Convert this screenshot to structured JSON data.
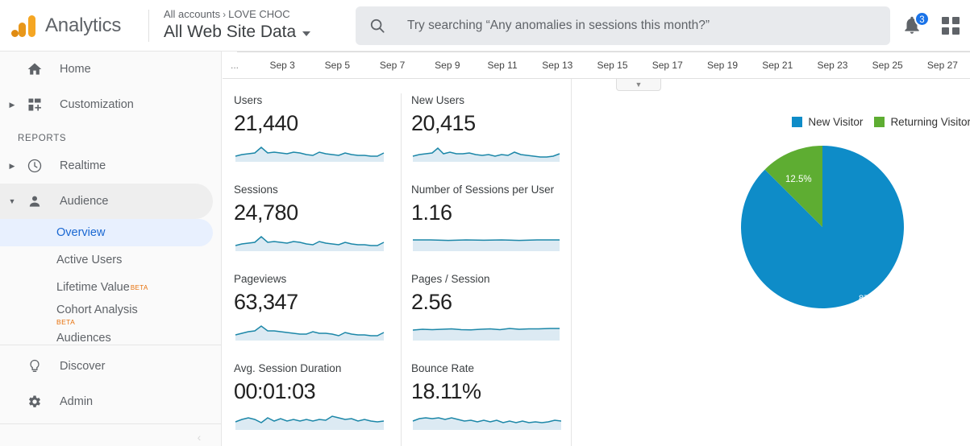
{
  "app": {
    "brand_name": "Analytics",
    "logo_icon": "analytics-logo-icon"
  },
  "header": {
    "breadcrumb_root": "All accounts",
    "breadcrumb_separator": "›",
    "breadcrumb_account": "LOVE CHOC",
    "property_title": "All Web Site Data",
    "property_caret_icon": "chevron-down-icon",
    "search": {
      "icon": "search-icon",
      "placeholder": "Try searching “Any anomalies in sessions this month?”",
      "value": ""
    },
    "notifications": {
      "icon": "bell-icon",
      "count": "3"
    },
    "apps_icon": "grid-apps-icon"
  },
  "sidebar": {
    "top_items": [
      {
        "label": "Home",
        "icon": "home-icon",
        "expandable": false,
        "selected": false
      },
      {
        "label": "Customization",
        "icon": "customization-icon",
        "expandable": true,
        "selected": false
      }
    ],
    "section_label": "REPORTS",
    "report_items": [
      {
        "label": "Realtime",
        "icon": "clock-icon",
        "expandable": true,
        "selected": false
      },
      {
        "label": "Audience",
        "icon": "person-icon",
        "expandable": true,
        "selected": true
      }
    ],
    "audience_subitems": [
      {
        "label": "Overview",
        "active": true,
        "beta": ""
      },
      {
        "label": "Active Users",
        "active": false,
        "beta": ""
      },
      {
        "label": "Lifetime Value",
        "active": false,
        "beta": "BETA"
      },
      {
        "label": "Cohort Analysis",
        "active": false,
        "beta": "BETA"
      }
    ],
    "clipped_item": "Audiences",
    "bottom_items": [
      {
        "label": "Discover",
        "icon": "lightbulb-icon"
      },
      {
        "label": "Admin",
        "icon": "gear-icon"
      }
    ],
    "collapse_icon": "collapse-arrow-icon"
  },
  "main": {
    "date_axis": {
      "leading_ellipsis": "...",
      "ticks": [
        "Sep 3",
        "Sep 5",
        "Sep 7",
        "Sep 9",
        "Sep 11",
        "Sep 13",
        "Sep 15",
        "Sep 17",
        "Sep 19",
        "Sep 21",
        "Sep 23",
        "Sep 25",
        "Sep 27"
      ],
      "toggle_icon": "chevron-down-icon"
    },
    "metrics": [
      {
        "title": "Users",
        "value": "21,440"
      },
      {
        "title": "New Users",
        "value": "20,415"
      },
      {
        "title": "Sessions",
        "value": "24,780"
      },
      {
        "title": "Number of Sessions per User",
        "value": "1.16"
      },
      {
        "title": "Pageviews",
        "value": "63,347"
      },
      {
        "title": "Pages / Session",
        "value": "2.56"
      },
      {
        "title": "Avg. Session Duration",
        "value": "00:01:03"
      },
      {
        "title": "Bounce Rate",
        "value": "18.11%"
      }
    ],
    "sparkline_color": "#1c87a8",
    "sparkline_fill": "#dceaf3"
  },
  "chart_data": {
    "type": "pie",
    "title": "",
    "legend_position": "top-right",
    "labels": [
      "New Visitor",
      "Returning Visitor"
    ],
    "values": [
      87.5,
      12.5
    ],
    "value_labels": [
      "87.5%",
      "12.5%"
    ],
    "colors": [
      "#0e8cc8",
      "#5ead32"
    ],
    "unit": "%"
  }
}
